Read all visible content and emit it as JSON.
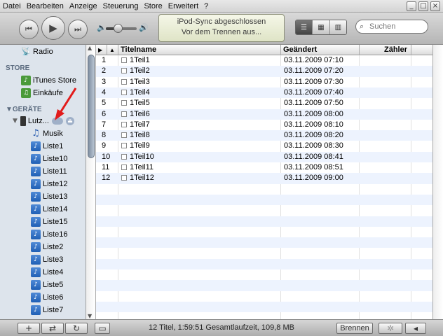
{
  "menu": [
    "Datei",
    "Bearbeiten",
    "Anzeige",
    "Steuerung",
    "Store",
    "Erweitert",
    "?"
  ],
  "window_controls": {
    "minimize": "_",
    "maximize": "□",
    "close": "×"
  },
  "player": {
    "prev_icon": "⏮",
    "play_icon": "▶",
    "next_icon": "⏭"
  },
  "volume": {
    "level": 0.55,
    "low_icon": "🔈",
    "high_icon": "🔊"
  },
  "lcd": {
    "line1": "iPod-Sync abgeschlossen",
    "line2": "Vor dem Trennen aus..."
  },
  "view_buttons": [
    "list-view-icon",
    "grid-view-icon",
    "coverflow-view-icon"
  ],
  "search": {
    "placeholder": "Suchen",
    "icon": "⌕"
  },
  "sidebar": {
    "radio": "Radio",
    "store_heading": "STORE",
    "itunes_store": "iTunes Store",
    "purchases": "Einkäufe",
    "devices_heading": "GERÄTE",
    "device": "Lutz...",
    "music": "Musik",
    "playlists": [
      "Liste1",
      "Liste10",
      "Liste11",
      "Liste12",
      "Liste13",
      "Liste14",
      "Liste15",
      "Liste16",
      "Liste2",
      "Liste3",
      "Liste4",
      "Liste5",
      "Liste6",
      "Liste7"
    ]
  },
  "list": {
    "columns": {
      "name": "Titelname",
      "changed": "Geändert",
      "count": "Zähler"
    },
    "rows": [
      {
        "num": "1",
        "name": "1Teil1",
        "changed": "03.11.2009 07:10"
      },
      {
        "num": "2",
        "name": "1Teil2",
        "changed": "03.11.2009 07:20"
      },
      {
        "num": "3",
        "name": "1Teil3",
        "changed": "03.11.2009 07:30"
      },
      {
        "num": "4",
        "name": "1Teil4",
        "changed": "03.11.2009 07:40"
      },
      {
        "num": "5",
        "name": "1Teil5",
        "changed": "03.11.2009 07:50"
      },
      {
        "num": "6",
        "name": "1Teil6",
        "changed": "03.11.2009 08:00"
      },
      {
        "num": "7",
        "name": "1Teil7",
        "changed": "03.11.2009 08:10"
      },
      {
        "num": "8",
        "name": "1Teil8",
        "changed": "03.11.2009 08:20"
      },
      {
        "num": "9",
        "name": "1Teil9",
        "changed": "03.11.2009 08:30"
      },
      {
        "num": "10",
        "name": "1Teil10",
        "changed": "03.11.2009 08:41"
      },
      {
        "num": "11",
        "name": "1Teil11",
        "changed": "03.11.2009 08:51"
      },
      {
        "num": "12",
        "name": "1Teil12",
        "changed": "03.11.2009 09:00"
      }
    ]
  },
  "status": "12 Titel, 1:59:51 Gesamtlaufzeit, 109,8 MB",
  "bottom": {
    "add_icon": "+",
    "shuffle_icon": "⇄",
    "repeat_icon": "↻",
    "artwork_icon": "▭",
    "burn_label": "Brennen",
    "visualizer_icon": "✲",
    "toggle_icon": "◂"
  }
}
